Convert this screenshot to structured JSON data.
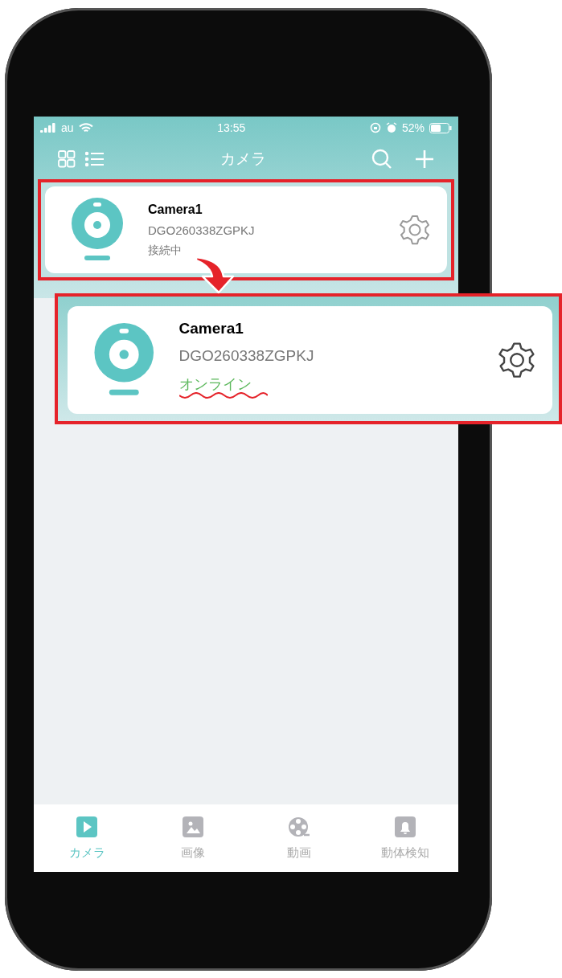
{
  "status_bar": {
    "carrier": "au",
    "time": "13:55",
    "battery": "52%"
  },
  "nav_bar": {
    "title": "カメラ"
  },
  "cameras": [
    {
      "name": "Camera1",
      "serial": "DGO260338ZGPKJ",
      "status": "接続中",
      "online": false
    }
  ],
  "callout": {
    "name": "Camera1",
    "serial": "DGO260338ZGPKJ",
    "status": "オンライン",
    "online": true
  },
  "tabs": [
    {
      "label": "カメラ",
      "kind": "play",
      "selected": true
    },
    {
      "label": "画像",
      "kind": "image",
      "selected": false
    },
    {
      "label": "動画",
      "kind": "film",
      "selected": false
    },
    {
      "label": "動体検知",
      "kind": "bell",
      "selected": false
    }
  ]
}
